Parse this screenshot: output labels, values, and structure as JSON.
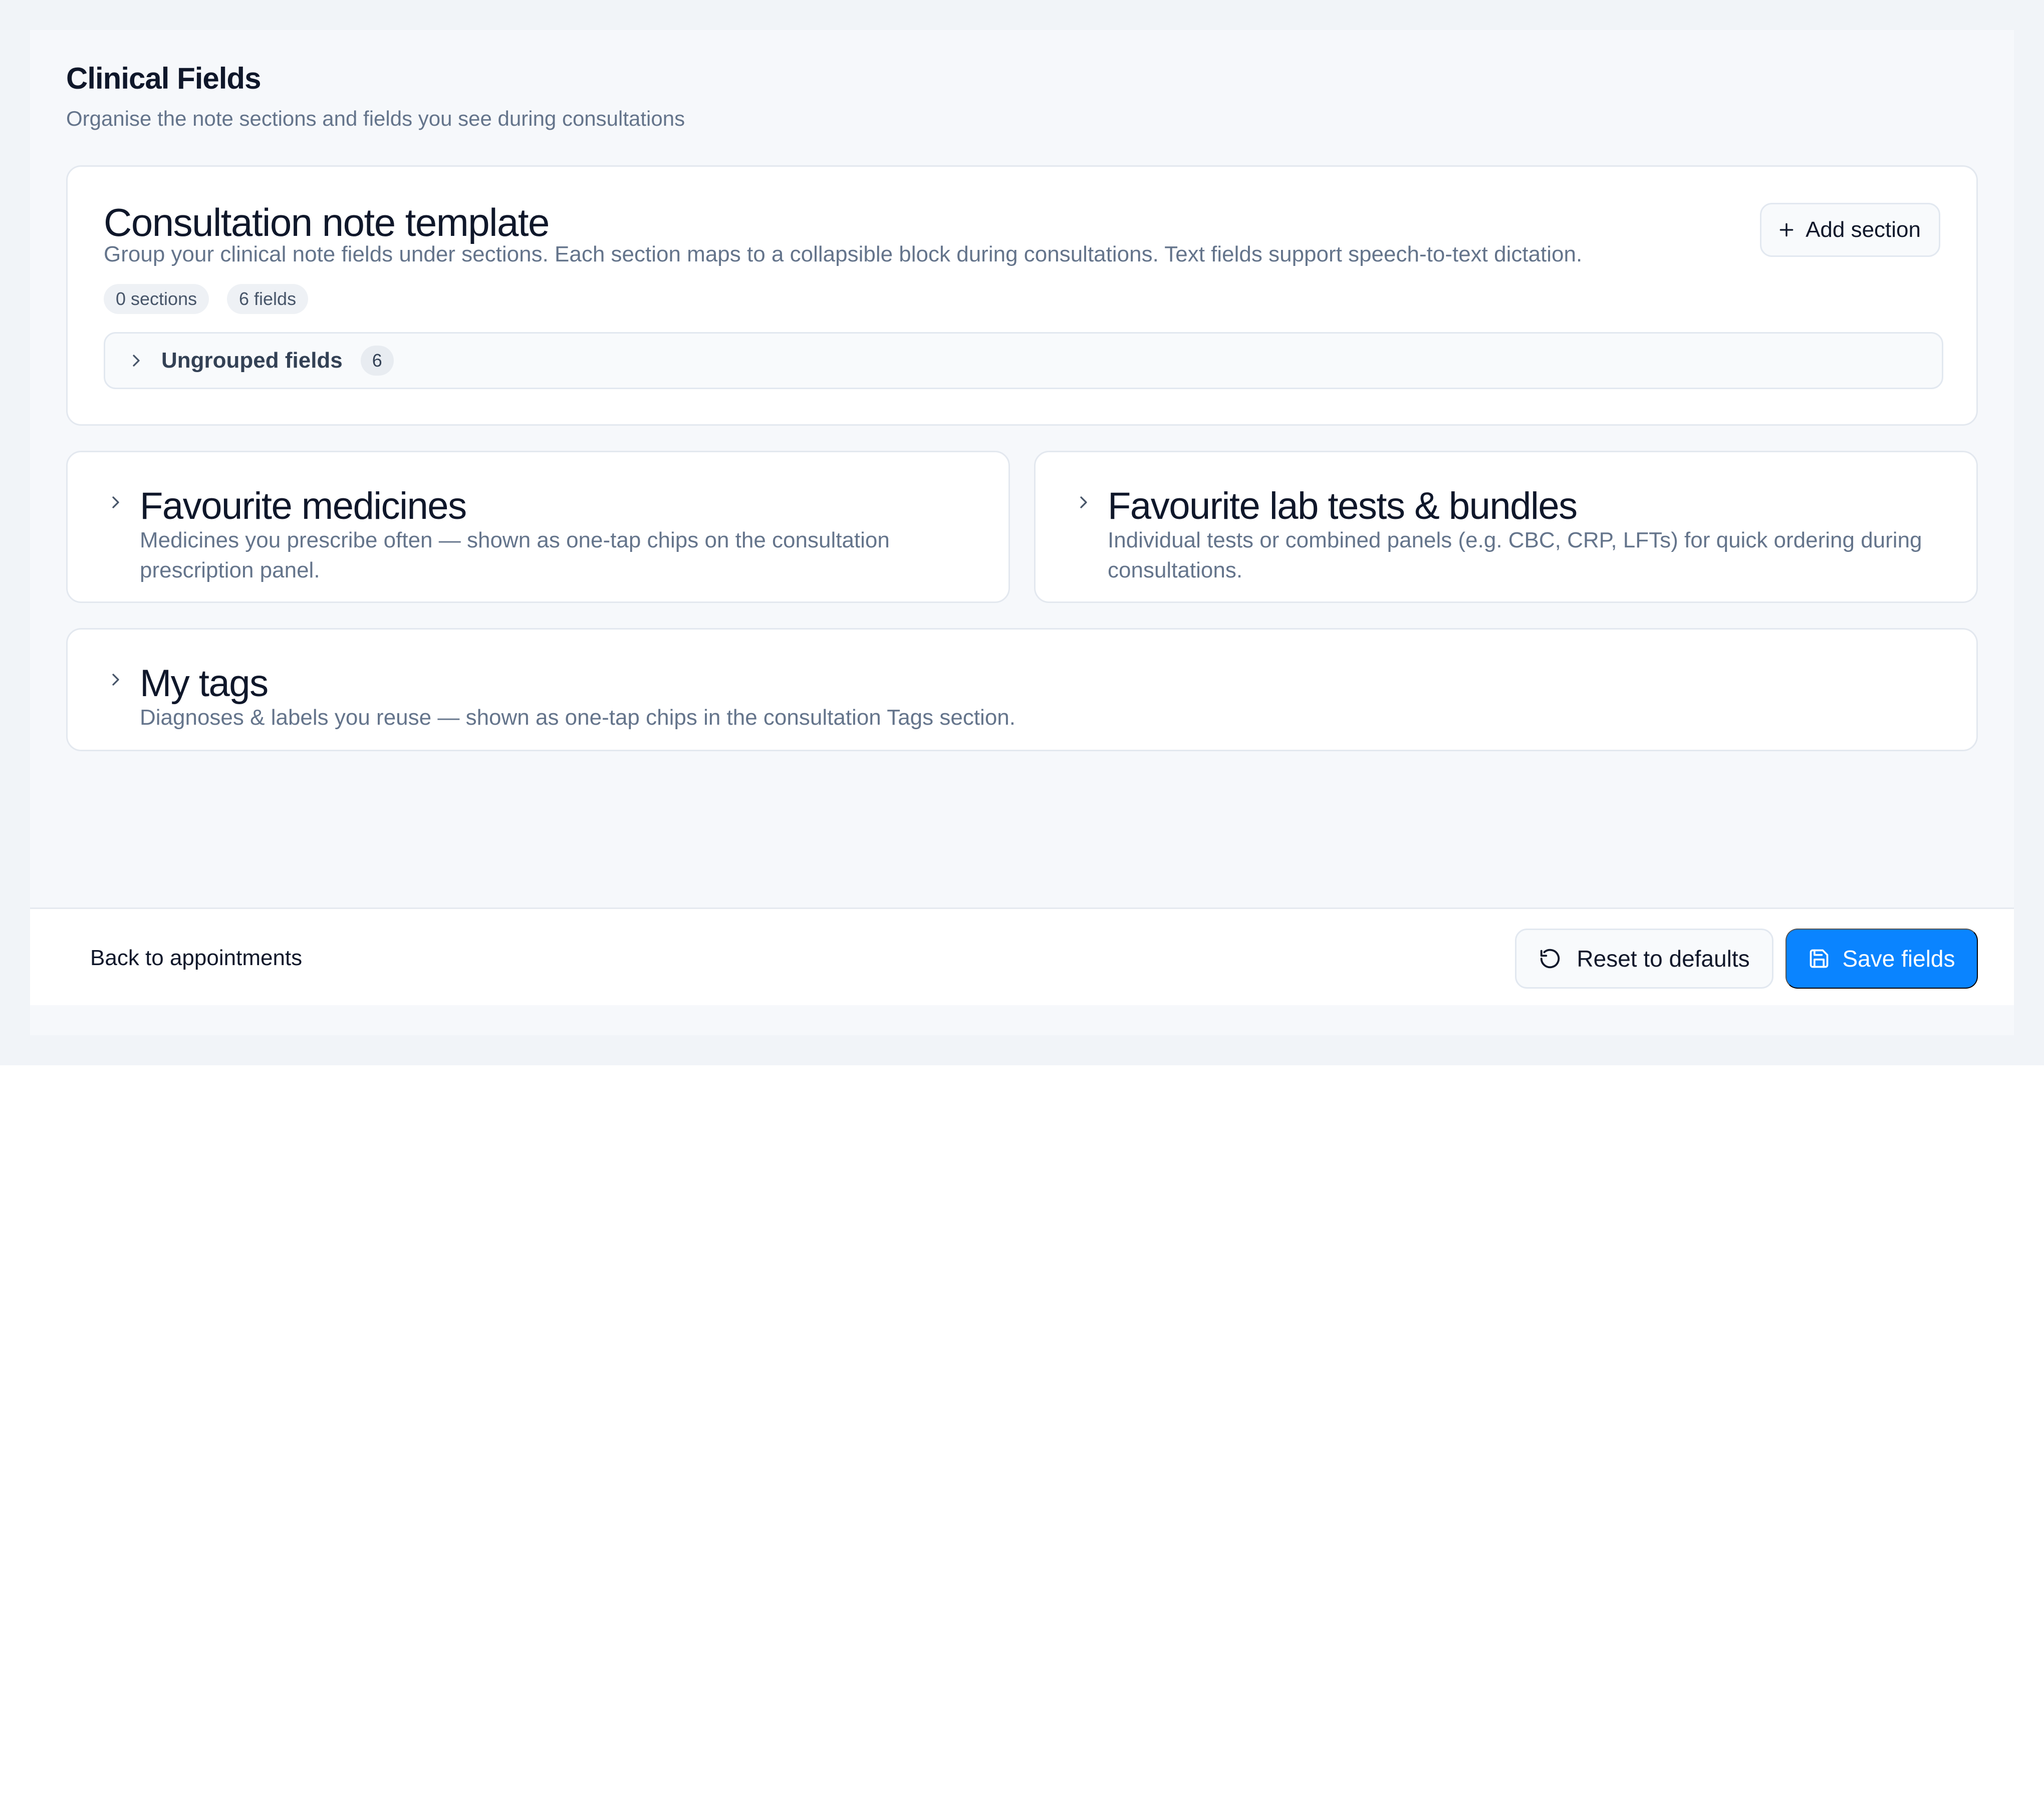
{
  "header": {
    "title": "Clinical Fields",
    "subtitle": "Organise the note sections and fields you see during consultations"
  },
  "template_card": {
    "title": "Consultation note template",
    "description": "Group your clinical note fields under sections. Each section maps to a collapsible block during consultations. Text fields support speech-to-text dictation.",
    "add_section_label": "Add section",
    "sections_chip": "0 sections",
    "fields_chip": "6 fields",
    "ungrouped": {
      "label": "Ungrouped fields",
      "count": "6"
    }
  },
  "medicines_card": {
    "title": "Favourite medicines",
    "description": "Medicines you prescribe often — shown as one-tap chips on the consultation prescription panel."
  },
  "labs_card": {
    "title": "Favourite lab tests & bundles",
    "description": "Individual tests or combined panels (e.g. CBC, CRP, LFTs) for quick ordering during consultations."
  },
  "tags_card": {
    "title": "My tags",
    "description": "Diagnoses & labels you reuse — shown as one-tap chips in the consultation Tags section."
  },
  "footer": {
    "back_label": "Back to appointments",
    "reset_label": "Reset to defaults",
    "save_label": "Save fields"
  },
  "colors": {
    "primary": "#0a84ff",
    "text": "#0f172a",
    "muted": "#64748b",
    "border": "#e3e8ef"
  },
  "icons": [
    "plus-icon",
    "chevron-right-icon",
    "reset-icon",
    "save-icon"
  ]
}
